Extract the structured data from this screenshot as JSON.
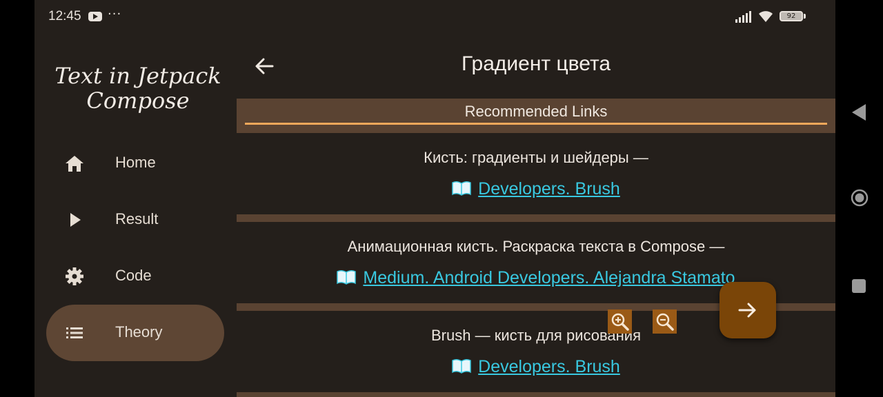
{
  "status_bar": {
    "time": "12:45",
    "more": "···",
    "battery": "92",
    "icons": [
      "youtube-icon",
      "signal-icon",
      "wifi-icon",
      "battery-icon"
    ]
  },
  "drawer": {
    "app_title_line1": "Text in Jetpack",
    "app_title_line2": "Compose",
    "items": [
      {
        "label": "Home",
        "icon": "home-icon",
        "active": false
      },
      {
        "label": "Result",
        "icon": "play-icon",
        "active": false
      },
      {
        "label": "Code",
        "icon": "gear-icon",
        "active": false
      },
      {
        "label": "Theory",
        "icon": "list-icon",
        "active": true
      }
    ]
  },
  "content": {
    "title": "Градиент цвета",
    "section_header": "Recommended Links",
    "links": [
      {
        "description": "Кисть: градиенты и шейдеры —",
        "link_icon": "📖",
        "link_text": "Developers. Brush"
      },
      {
        "description": "Анимационная кисть. Раскраска текста в Compose —",
        "link_icon": "📖",
        "link_text": "Medium. Android Developers. Alejandra Stamato"
      },
      {
        "description": "Brush — кисть для рисования",
        "link_icon": "📖",
        "link_text": "Developers. Brush"
      }
    ]
  },
  "colors": {
    "background": "#241f1b",
    "band": "#5a4332",
    "accent_underline": "#f2a85a",
    "link": "#39c8e0",
    "fab": "#7a4508",
    "active_nav": "#5e4634",
    "zoom_buttons": "#9a5a16"
  }
}
